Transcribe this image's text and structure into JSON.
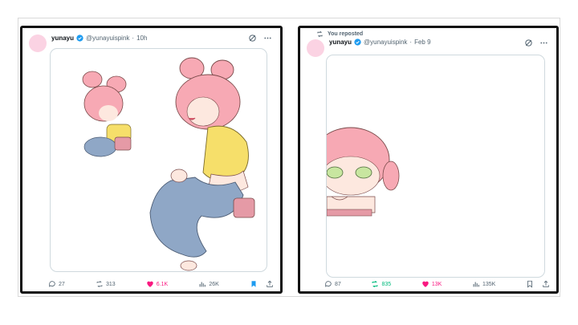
{
  "colors": {
    "like": "#f91880",
    "repost": "#00ba7c",
    "bookmark": "#1d9bf0",
    "verified": "#1d9bf0",
    "avatar": "#fbd3e3"
  },
  "posts": [
    {
      "display_name": "yunayu",
      "handle": "@yunayuispink",
      "time": "10h",
      "separator": "·",
      "stats": {
        "replies": "27",
        "reposts": "313",
        "likes": "6.1K",
        "views": "26K"
      },
      "liked": true,
      "bookmarked": true,
      "reposted": false
    },
    {
      "repost_label": "You reposted",
      "display_name": "yunayu",
      "handle": "@yunayuispink",
      "time": "Feb 9",
      "separator": "·",
      "stats": {
        "replies": "87",
        "reposts": "835",
        "likes": "13K",
        "views": "135K"
      },
      "liked": true,
      "bookmarked": false,
      "reposted": true
    }
  ]
}
